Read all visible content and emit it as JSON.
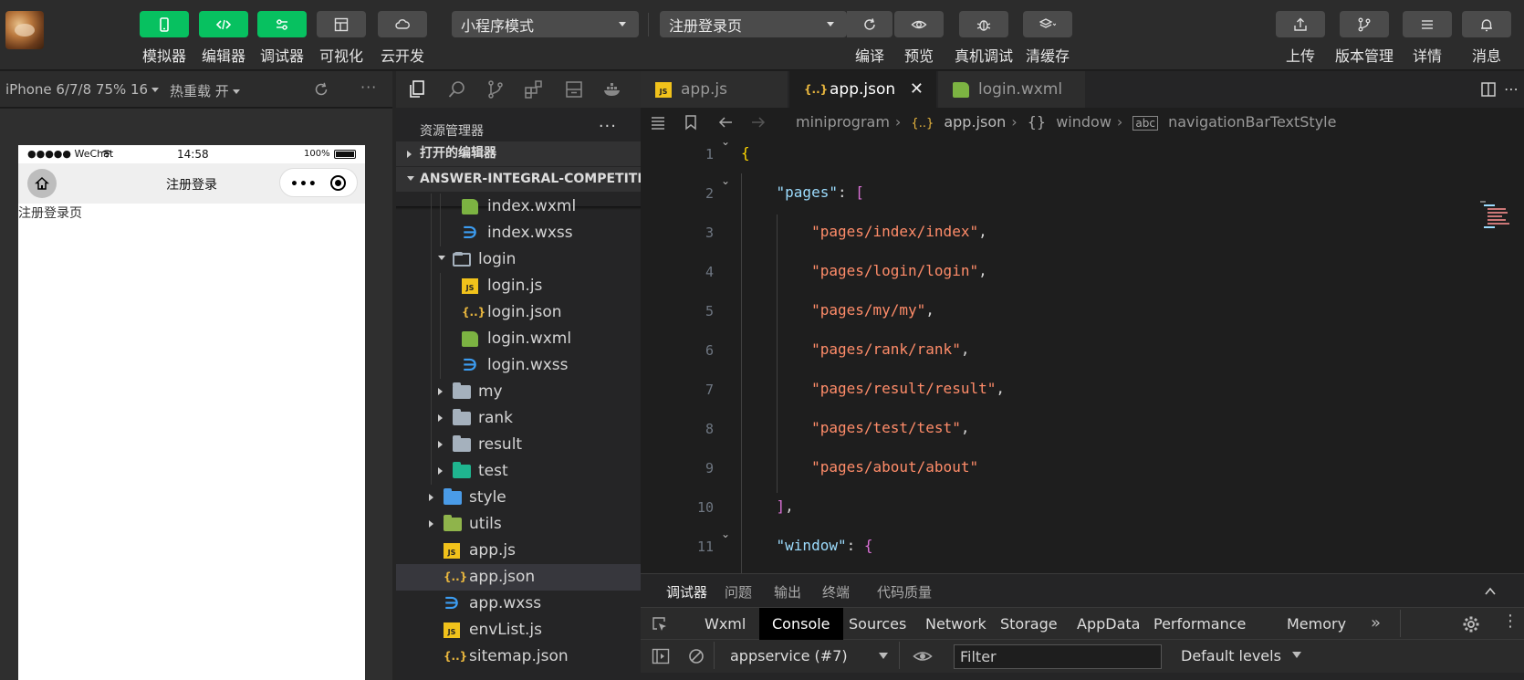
{
  "toolbar": {
    "left_buttons": [
      {
        "label": "模拟器",
        "icon": "phone-icon",
        "active": true
      },
      {
        "label": "编辑器",
        "icon": "code-icon",
        "active": true
      },
      {
        "label": "调试器",
        "icon": "sliders-icon",
        "active": true
      },
      {
        "label": "可视化",
        "icon": "layout-icon",
        "active": false
      },
      {
        "label": "云开发",
        "icon": "cloud-icon",
        "active": false
      }
    ],
    "mode_select": "小程序模式",
    "page_select": "注册登录页",
    "mid_actions": [
      {
        "label": "编译",
        "icon": "refresh-icon"
      },
      {
        "label": "预览",
        "icon": "eye-icon"
      },
      {
        "label": "真机调试",
        "icon": "bug-icon"
      },
      {
        "label": "清缓存",
        "icon": "layers-icon"
      }
    ],
    "right_actions": [
      {
        "label": "上传",
        "icon": "upload-icon"
      },
      {
        "label": "版本管理",
        "icon": "branch-icon"
      },
      {
        "label": "详情",
        "icon": "menu-icon"
      },
      {
        "label": "消息",
        "icon": "bell-icon"
      }
    ]
  },
  "simulator": {
    "device": "iPhone 6/7/8 75% 16",
    "hot_reload": "热重载 开",
    "status_left": "●●●●● WeChat",
    "status_time": "14:58",
    "status_battery": "100%",
    "nav_title": "注册登录",
    "page_text": "注册登录页"
  },
  "explorer": {
    "title": "资源管理器",
    "open_editors": "打开的编辑器",
    "project": "ANSWER-INTEGRAL-COMPETITI...",
    "tree": [
      {
        "name": "index.wxml",
        "type": "wxml"
      },
      {
        "name": "index.wxss",
        "type": "wxss"
      },
      {
        "name": "login",
        "type": "folder-open"
      },
      {
        "name": "login.js",
        "type": "js"
      },
      {
        "name": "login.json",
        "type": "json"
      },
      {
        "name": "login.wxml",
        "type": "wxml"
      },
      {
        "name": "login.wxss",
        "type": "wxss"
      },
      {
        "name": "my",
        "type": "folder"
      },
      {
        "name": "rank",
        "type": "folder"
      },
      {
        "name": "result",
        "type": "folder"
      },
      {
        "name": "test",
        "type": "folder-test"
      },
      {
        "name": "style",
        "type": "folder-style"
      },
      {
        "name": "utils",
        "type": "folder-utils"
      },
      {
        "name": "app.js",
        "type": "js"
      },
      {
        "name": "app.json",
        "type": "json"
      },
      {
        "name": "app.wxss",
        "type": "wxss"
      },
      {
        "name": "envList.js",
        "type": "js"
      },
      {
        "name": "sitemap.json",
        "type": "json"
      }
    ]
  },
  "editor": {
    "tabs": [
      {
        "name": "app.js",
        "type": "js"
      },
      {
        "name": "app.json",
        "type": "json"
      },
      {
        "name": "login.wxml",
        "type": "wxml"
      }
    ],
    "breadcrumb": {
      "root": "miniprogram",
      "file": "app.json",
      "node": "window",
      "leaf": "navigationBarTextStyle"
    },
    "code_lines": [
      {
        "n": "1",
        "text": "{"
      },
      {
        "n": "2",
        "key": "\"pages\"",
        "rest": ": ["
      },
      {
        "n": "3",
        "str": "\"pages/index/index\""
      },
      {
        "n": "4",
        "str": "\"pages/login/login\""
      },
      {
        "n": "5",
        "str": "\"pages/my/my\""
      },
      {
        "n": "6",
        "str": "\"pages/rank/rank\""
      },
      {
        "n": "7",
        "str": "\"pages/result/result\""
      },
      {
        "n": "8",
        "str": "\"pages/test/test\""
      },
      {
        "n": "9",
        "str": "\"pages/about/about\""
      },
      {
        "n": "10",
        "text": "],"
      },
      {
        "n": "11",
        "key": "\"window\"",
        "rest": ": {"
      }
    ]
  },
  "debugger": {
    "panel_tabs": [
      "调试器",
      "问题",
      "输出",
      "终端",
      "代码质量"
    ],
    "devtools_tabs": [
      "Wxml",
      "Console",
      "Sources",
      "Network",
      "Storage",
      "AppData",
      "Performance",
      "Memory"
    ],
    "more": "»",
    "context": "appservice (#7)",
    "filter_placeholder": "Filter",
    "levels": "Default levels"
  }
}
